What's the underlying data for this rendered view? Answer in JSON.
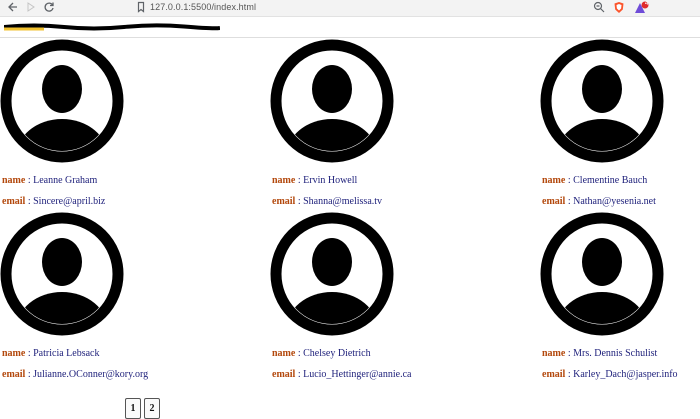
{
  "browser": {
    "url": "127.0.0.1:5500/index.html",
    "icons": [
      "back-icon",
      "forward-icon",
      "reload-icon",
      "bookmark-icon",
      "info-icon",
      "zoom-icon",
      "brave-shield-icon",
      "rewards-icon"
    ],
    "rewards_badge": "4"
  },
  "labels": {
    "name": "name",
    "email": "email",
    "separator": " : "
  },
  "users": [
    {
      "name": "Leanne Graham",
      "email": "Sincere@april.biz"
    },
    {
      "name": "Ervin Howell",
      "email": "Shanna@melissa.tv"
    },
    {
      "name": "Clementine Bauch",
      "email": "Nathan@yesenia.net"
    },
    {
      "name": "Patricia Lebsack",
      "email": "Julianne.OConner@kory.org"
    },
    {
      "name": "Chelsey Dietrich",
      "email": "Lucio_Hettinger@annie.ca"
    },
    {
      "name": "Mrs. Dennis Schulist",
      "email": "Karley_Dach@jasper.info"
    }
  ],
  "pagination": {
    "pages": [
      "1",
      "2"
    ],
    "current": "1"
  },
  "colors": {
    "label": "#b3480c",
    "value": "#1d1f7a",
    "avatar": "#000000"
  }
}
